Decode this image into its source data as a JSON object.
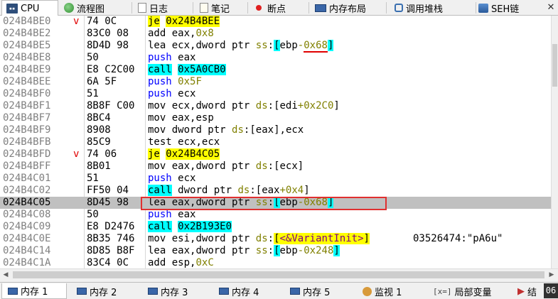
{
  "tabs": [
    {
      "label": "CPU",
      "icon": "cpu-icon",
      "active": true
    },
    {
      "label": "流程图",
      "icon": "flowchart-icon"
    },
    {
      "label": "日志",
      "icon": "log-icon"
    },
    {
      "label": "笔记",
      "icon": "notes-icon"
    },
    {
      "label": "断点",
      "icon": "breakpoint-icon"
    },
    {
      "label": "内存布局",
      "icon": "memory-map-icon"
    },
    {
      "label": "调用堆栈",
      "icon": "call-stack-icon"
    },
    {
      "label": "SEH链",
      "icon": "seh-chain-icon"
    }
  ],
  "tab_close_glyph": "✕",
  "disasm": {
    "rows": [
      {
        "addr": "024B4BE0",
        "jmp": "v",
        "bytes": "74 0C"
      },
      {
        "addr": "024B4BE2",
        "jmp": "",
        "bytes": "83C0 08"
      },
      {
        "addr": "024B4BE5",
        "jmp": "",
        "bytes": "8D4D 98"
      },
      {
        "addr": "024B4BE8",
        "jmp": "",
        "bytes": "50"
      },
      {
        "addr": "024B4BE9",
        "jmp": "",
        "bytes": "E8 C2C00"
      },
      {
        "addr": "024B4BEE",
        "jmp": "",
        "bytes": "6A 5F"
      },
      {
        "addr": "024B4BF0",
        "jmp": "",
        "bytes": "51"
      },
      {
        "addr": "024B4BF1",
        "jmp": "",
        "bytes": "8B8F C00"
      },
      {
        "addr": "024B4BF7",
        "jmp": "",
        "bytes": "8BC4"
      },
      {
        "addr": "024B4BF9",
        "jmp": "",
        "bytes": "8908"
      },
      {
        "addr": "024B4BFB",
        "jmp": "",
        "bytes": "85C9"
      },
      {
        "addr": "024B4BFD",
        "jmp": "v",
        "bytes": "74 06"
      },
      {
        "addr": "024B4BFF",
        "jmp": "",
        "bytes": "8B01"
      },
      {
        "addr": "024B4C01",
        "jmp": "",
        "bytes": "51"
      },
      {
        "addr": "024B4C02",
        "jmp": "",
        "bytes": "FF50 04"
      },
      {
        "addr": "024B4C05",
        "jmp": "",
        "bytes": "8D45 98"
      },
      {
        "addr": "024B4C08",
        "jmp": "",
        "bytes": "50"
      },
      {
        "addr": "024B4C09",
        "jmp": "",
        "bytes": "E8 D2476"
      },
      {
        "addr": "024B4C0E",
        "jmp": "",
        "bytes": "8B35 746"
      },
      {
        "addr": "024B4C14",
        "jmp": "",
        "bytes": "8D85 B8F"
      },
      {
        "addr": "024B4C1A",
        "jmp": "",
        "bytes": "83C4 0C"
      }
    ],
    "instr": {
      "r0": {
        "mn": "je",
        "op": "0x24B4BEE"
      },
      "r1": {
        "mn": "add",
        "a": "eax",
        "c": ",",
        "b": "0x8"
      },
      "r2": {
        "mn": "lea",
        "a": "ecx",
        "c": ",",
        "sz": "dword ptr ",
        "seg": "ss",
        "col": ":",
        "lb": "[",
        "reg": "ebp",
        "sign": "-",
        "off": "0x68",
        "rb": "]"
      },
      "r3": {
        "mn": "push",
        "a": "eax"
      },
      "r4": {
        "mn": "call",
        "op": "0x5A0CB0"
      },
      "r5": {
        "mn": "push",
        "a": "0x5F"
      },
      "r6": {
        "mn": "push",
        "a": "ecx"
      },
      "r7": {
        "mn": "mov",
        "a": "ecx",
        "c": ",",
        "sz": "dword ptr ",
        "seg": "ds",
        "col": ":",
        "lb": "[",
        "reg": "edi",
        "sign": "+",
        "off": "0x2C0",
        "rb": "]"
      },
      "r8": {
        "mn": "mov",
        "a": "eax",
        "c": ",",
        "b": "esp"
      },
      "r9": {
        "mn": "mov",
        "sz": "dword ptr ",
        "seg": "ds",
        "col": ":",
        "lb": "[",
        "reg": "eax",
        "rb": "]",
        "c": ",",
        "b": "ecx"
      },
      "r10": {
        "mn": "test",
        "a": "ecx",
        "c": ",",
        "b": "ecx"
      },
      "r11": {
        "mn": "je",
        "op": "0x24B4C05"
      },
      "r12": {
        "mn": "mov",
        "a": "eax",
        "c": ",",
        "sz": "dword ptr ",
        "seg": "ds",
        "col": ":",
        "lb": "[",
        "reg": "ecx",
        "rb": "]"
      },
      "r13": {
        "mn": "push",
        "a": "ecx"
      },
      "r14": {
        "mn": "call",
        "sz": "dword ptr ",
        "seg": "ds",
        "col": ":",
        "lb": "[",
        "reg": "eax",
        "sign": "+",
        "off": "0x4",
        "rb": "]"
      },
      "r15": {
        "mn": "lea",
        "a": "eax",
        "c": ",",
        "sz": "dword ptr ",
        "seg": "ss",
        "col": ":",
        "lb": "[",
        "reg": "ebp",
        "sign": "-",
        "off": "0x68",
        "rb": "]"
      },
      "r16": {
        "mn": "push",
        "a": "eax"
      },
      "r17": {
        "mn": "call",
        "op": "0x2B193E0"
      },
      "r18": {
        "mn": "mov",
        "a": "esi",
        "c": ",",
        "sz": "dword ptr ",
        "seg": "ds",
        "col": ":",
        "lb": "[",
        "sym": "<&VariantInit>",
        "rb": "]",
        "comment": "03526474:\"pA6u\""
      },
      "r19": {
        "mn": "lea",
        "a": "eax",
        "c": ",",
        "sz": "dword ptr ",
        "seg": "ss",
        "col": ":",
        "lb": "[",
        "reg": "ebp",
        "sign": "-",
        "off": "0x248",
        "rb": "]"
      },
      "r20": {
        "mn": "add",
        "a": "esp",
        "c": ",",
        "b": "0xC"
      }
    },
    "selected_row": 15
  },
  "scroll": {
    "left_arrow": "◀",
    "right_arrow": "▶"
  },
  "bottom_tabs": [
    {
      "label": "内存 1",
      "icon": "memory-icon",
      "active": true
    },
    {
      "label": "内存 2",
      "icon": "memory-icon"
    },
    {
      "label": "内存 3",
      "icon": "memory-icon"
    },
    {
      "label": "内存 4",
      "icon": "memory-icon"
    },
    {
      "label": "内存 5",
      "icon": "memory-icon"
    },
    {
      "label": "监视 1",
      "icon": "watch-icon"
    },
    {
      "label": "局部变量",
      "icon": "locals-icon",
      "prefix": "[x=]"
    },
    {
      "label": "结",
      "icon": "struct-icon"
    }
  ],
  "corner_badge": "06"
}
